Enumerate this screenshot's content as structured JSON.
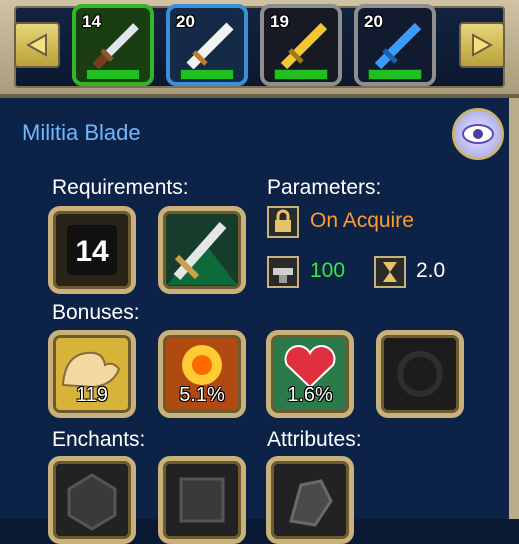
{
  "weapon_slots": [
    {
      "level": "14",
      "selected": true
    },
    {
      "level": "20",
      "selected": false
    },
    {
      "level": "19",
      "selected": false
    },
    {
      "level": "20",
      "selected": false
    }
  ],
  "item_name": "Militia Blade",
  "labels": {
    "requirements": "Requirements:",
    "parameters": "Parameters:",
    "bonuses": "Bonuses:",
    "enchants": "Enchants:",
    "attributes": "Attributes:"
  },
  "requirements": {
    "level": "14"
  },
  "parameters": {
    "bind": "On Acquire",
    "damage": "100",
    "speed": "2.0"
  },
  "bonuses": [
    {
      "icon": "strength-arm-icon",
      "value": "119"
    },
    {
      "icon": "fire-crit-icon",
      "value": "5.1%"
    },
    {
      "icon": "heart-shield-icon",
      "value": "1.6%"
    },
    {
      "icon": "empty-slot-icon",
      "value": ""
    }
  ],
  "colors": {
    "accent": "#6fb7ff",
    "bind": "#ff9b2e",
    "damage": "#36e83b",
    "frame": "#c8b27a"
  }
}
